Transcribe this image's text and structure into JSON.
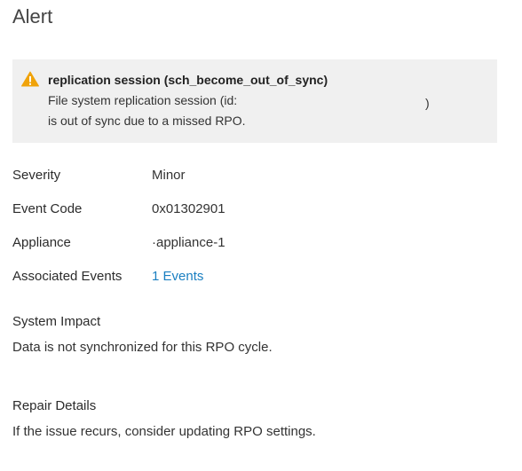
{
  "page": {
    "title": "Alert"
  },
  "alert": {
    "icon": "warning-icon",
    "title": "replication session (sch_become_out_of_sync)",
    "line1": "File system replication session (id:",
    "line1_tail": ")",
    "line2": "is out of sync due to a missed RPO.",
    "icon_color": "#f0a30a"
  },
  "details": [
    {
      "label": "Severity",
      "value": "Minor",
      "is_link": false
    },
    {
      "label": "Event Code",
      "value": "0x01302901",
      "is_link": false
    },
    {
      "label": "Appliance",
      "value": "·appliance-1",
      "is_link": false
    },
    {
      "label": "Associated Events",
      "value": "1 Events",
      "is_link": true
    }
  ],
  "system_impact": {
    "heading": "System Impact",
    "text": "Data is not synchronized for this RPO cycle."
  },
  "repair_details": {
    "heading": "Repair Details",
    "text": "If the issue recurs, consider updating RPO settings."
  },
  "colors": {
    "link": "#1a7fc1",
    "alert_background": "#f0f0f0"
  }
}
